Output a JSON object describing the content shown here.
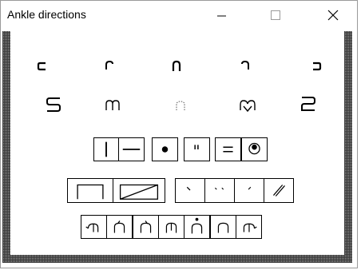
{
  "window": {
    "title": "Ankle directions",
    "controls": [
      "minimize-icon",
      "maximize-icon",
      "close-icon"
    ]
  },
  "palette": {
    "row1_icons": [
      "ankle-left-icon",
      "ankle-back-left-icon",
      "ankle-back-icon",
      "ankle-back-right-icon",
      "ankle-right-icon"
    ],
    "row2_icons": [
      "ankle-s-turn-icon",
      "ankle-double-arch-icon",
      "ankle-dotted-arch-icon",
      "ankle-heart-icon",
      "ankle-z-turn-icon"
    ],
    "row3_icons": [
      "vertical-bar-icon",
      "horizontal-bar-icon",
      "dot-icon",
      "double-tick-icon",
      "equals-icon",
      "circled-dot-icon"
    ],
    "row4a_icons": [
      "open-box-icon",
      "slashed-box-icon"
    ],
    "row4b_icons": [
      "left-tick-icon",
      "double-small-tick-icon",
      "right-tick-icon",
      "double-slash-icon"
    ],
    "row5_icons": [
      "hook-arch-left-icon",
      "arch-left-tick-icon",
      "arch-right-tick-icon",
      "arch-center-tick-icon",
      "arch-dot-icon",
      "arch-plain-icon",
      "hook-arch-right-icon"
    ]
  }
}
